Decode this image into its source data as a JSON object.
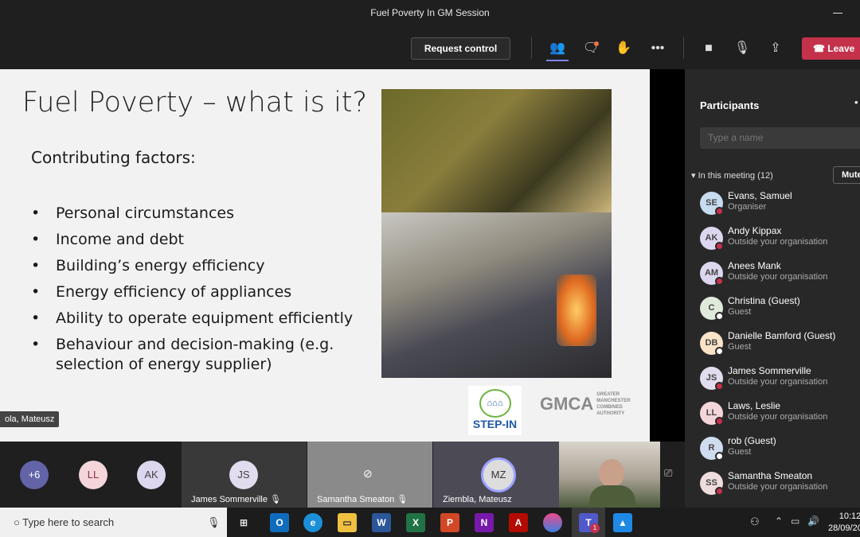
{
  "window": {
    "title": "Fuel Poverty In GM Session"
  },
  "toolbar": {
    "request_control": "Request control",
    "leave": "Leave",
    "colors": {
      "leave": "#c4314b",
      "active": "#7f85f5"
    }
  },
  "slide": {
    "title": "Fuel Poverty – what is it?",
    "subtitle": "Contributing factors:",
    "bullets": [
      "Personal circumstances",
      "Income and debt",
      "Building’s energy efficiency",
      "Energy efficiency of appliances",
      "Ability to operate equipment efficiently",
      "Behaviour and decision-making (e.g. selection of energy supplier)"
    ],
    "logo_stepin": "STEP-IN",
    "logo_gmca": "GMCA",
    "logo_gmca_sub": "GREATER MANCHESTER COMBINED AUTHORITY",
    "presenter_label": "ola, Mateusz"
  },
  "participants": {
    "title": "Participants",
    "search_placeholder": "Type a name",
    "section": "In this meeting (12)",
    "mute_all": "Mute",
    "people": [
      {
        "initials": "SE",
        "name": "Evans, Samuel",
        "role": "Organiser",
        "color": "#c7dcf0",
        "status": "#c4314b"
      },
      {
        "initials": "AK",
        "name": "Andy Kippax",
        "role": "Outside your organisation",
        "color": "#dcd6ee",
        "status": "#c4314b"
      },
      {
        "initials": "AM",
        "name": "Anees Mank",
        "role": "Outside your organisation",
        "color": "#dcd6ee",
        "status": "#c4314b"
      },
      {
        "initials": "C",
        "name": "Christina (Guest)",
        "role": "Guest",
        "color": "#dfeadb",
        "status": "#ffffff"
      },
      {
        "initials": "DB",
        "name": "Danielle Bamford (Guest)",
        "role": "Guest",
        "color": "#fbe3c8",
        "status": "#ffffff"
      },
      {
        "initials": "JS",
        "name": "James Sommerville",
        "role": "Outside your organisation",
        "color": "#e2dcef",
        "status": "#c4314b"
      },
      {
        "initials": "LL",
        "name": "Laws, Leslie",
        "role": "Outside your organisation",
        "color": "#f4d6da",
        "status": "#c4314b"
      },
      {
        "initials": "R",
        "name": "rob (Guest)",
        "role": "Guest",
        "color": "#cfdcef",
        "status": "#ffffff"
      },
      {
        "initials": "SS",
        "name": "Samantha Smeaton",
        "role": "Outside your organisation",
        "color": "#efdcdc",
        "status": "#c4314b"
      }
    ]
  },
  "gallery": {
    "overflow": "+6",
    "avatars": [
      "LL",
      "AK"
    ],
    "tiles": [
      {
        "initials": "JS",
        "name": "James Sommerville"
      },
      {
        "name": "Samantha Smeaton"
      },
      {
        "initials": "MZ",
        "name": "Ziembla, Mateusz"
      }
    ]
  },
  "taskbar": {
    "search_placeholder": "Type here to search",
    "time": "10:12",
    "date": "28/09/2020",
    "teams_badge": "1"
  }
}
